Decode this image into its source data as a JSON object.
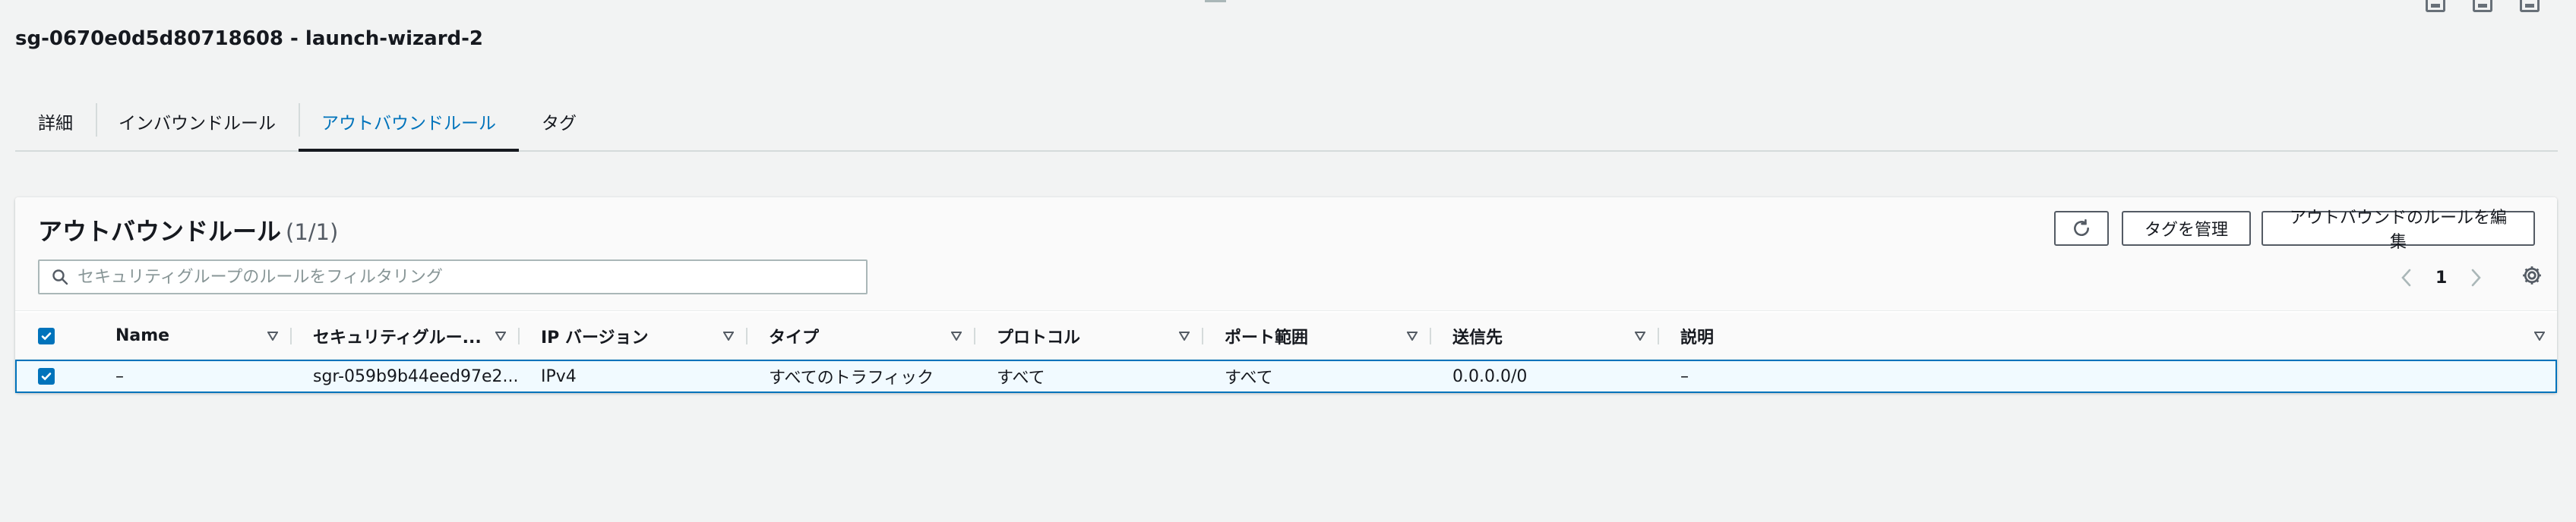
{
  "page": {
    "title": "sg-0670e0d5d80718608 - launch-wizard-2"
  },
  "tabs": [
    {
      "label": "詳細",
      "active": false
    },
    {
      "label": "インバウンドルール",
      "active": false
    },
    {
      "label": "アウトバウンドルール",
      "active": true
    },
    {
      "label": "タグ",
      "active": false
    }
  ],
  "panel": {
    "title": "アウトバウンドルール",
    "count": "(1/1)",
    "buttons": {
      "refresh_icon": "refresh-icon",
      "manage_tags": "タグを管理",
      "edit_rules": "アウトバウンドのルールを編集"
    },
    "search": {
      "placeholder": "セキュリティグループのルールをフィルタリング",
      "value": ""
    },
    "pagination": {
      "current_page": "1"
    }
  },
  "table": {
    "columns": [
      {
        "label": "Name"
      },
      {
        "label": "セキュリティグルー..."
      },
      {
        "label": "IP バージョン"
      },
      {
        "label": "タイプ"
      },
      {
        "label": "プロトコル"
      },
      {
        "label": "ポート範囲"
      },
      {
        "label": "送信先"
      },
      {
        "label": "説明"
      }
    ],
    "rows": [
      {
        "selected": true,
        "cells": [
          "–",
          "sgr-059b9b44eed97e2...",
          "IPv4",
          "すべてのトラフィック",
          "すべて",
          "すべて",
          "0.0.0.0/0",
          "–"
        ]
      }
    ]
  },
  "colors": {
    "accent": "#0073bb",
    "background": "#f2f3f3",
    "selected_row": "#f1faff"
  }
}
